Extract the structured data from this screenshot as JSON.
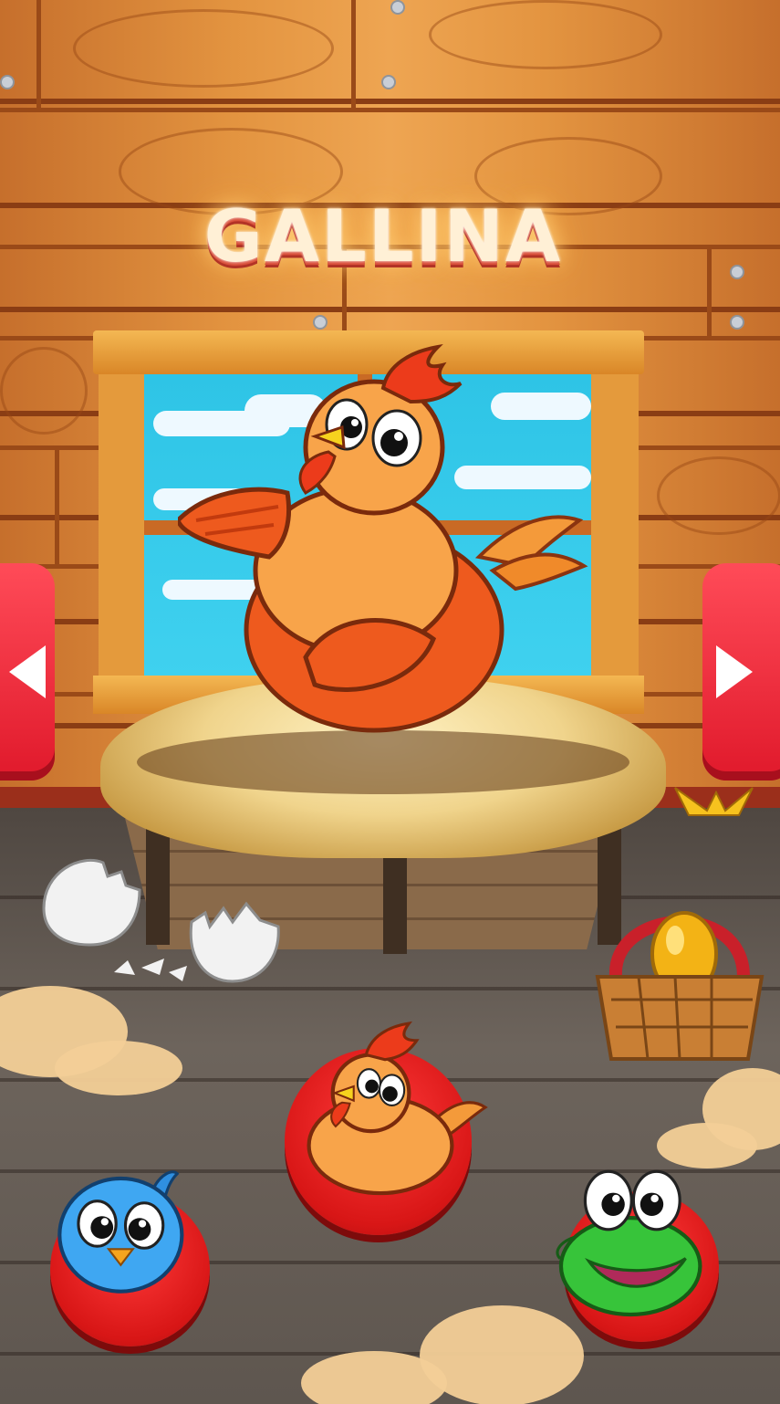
{
  "scene": {
    "title": "GALLINA",
    "current_animal": "hen"
  },
  "navigation": {
    "prev_icon": "play-left-icon",
    "next_icon": "play-right-icon"
  },
  "selector": {
    "items": [
      {
        "animal": "bird",
        "icon": "blue-bird-icon",
        "selected": false
      },
      {
        "animal": "hen",
        "icon": "hen-icon",
        "selected": true
      },
      {
        "animal": "frog",
        "icon": "frog-icon",
        "selected": false
      }
    ]
  },
  "colors": {
    "accent_red": "#e0192b",
    "wall_wood": "#e39440",
    "sky": "#2ec4e6",
    "title_text": "#fff0d6"
  }
}
